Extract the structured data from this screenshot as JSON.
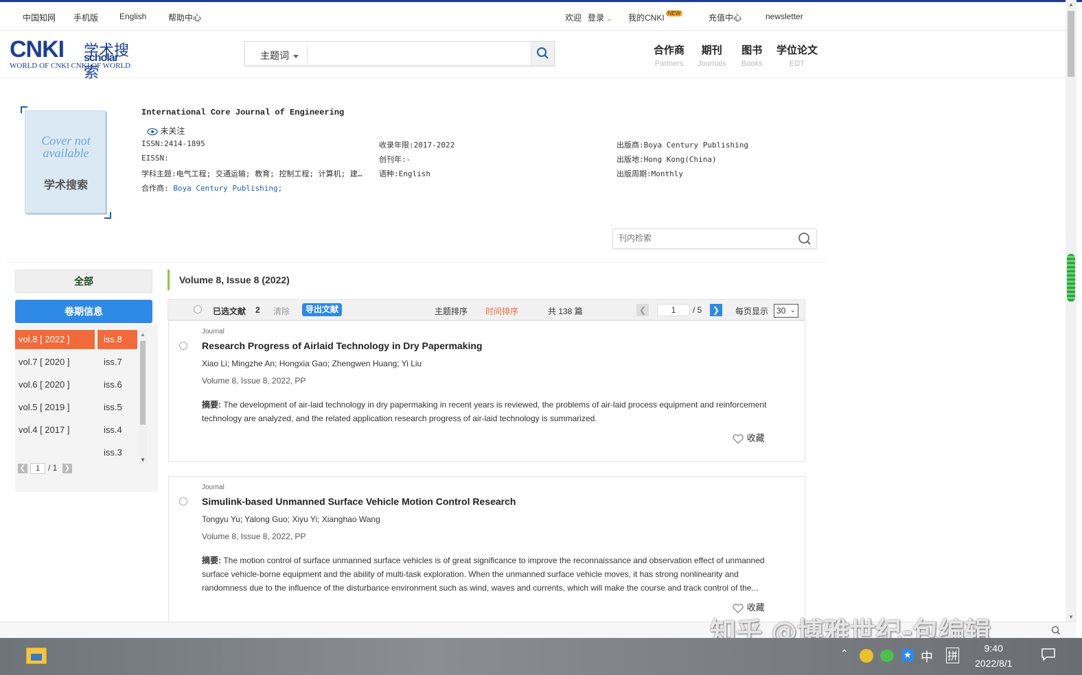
{
  "topbar": {
    "cnki_home": "中国知网",
    "mobile": "手机版",
    "english": "English",
    "help": "帮助中心",
    "welcome": "欢迎",
    "login": "登录",
    "my_cnki": "我的CNKI",
    "new_badge": "NEW",
    "recharge": "充值中心",
    "newsletter": "newsletter"
  },
  "logo": {
    "main": "CNKI",
    "cn": "学术搜索",
    "scholar": "scholar",
    "sub": "WORLD OF CNKI CNKI OF WORLD"
  },
  "search": {
    "type": "主题词",
    "placeholder": ""
  },
  "nav": [
    {
      "cn": "合作商",
      "en": "Partners"
    },
    {
      "cn": "期刊",
      "en": "Journals"
    },
    {
      "cn": "图书",
      "en": "Books"
    },
    {
      "cn": "学位论文",
      "en": "EDT"
    }
  ],
  "cover": {
    "text": "Cover not available",
    "logo_text": "学术搜索"
  },
  "journal": {
    "title": "International Core Journal of Engineering",
    "follow": "未关注",
    "issn": "ISSN:2414-1895",
    "eissn": "EISSN:",
    "subjects": "学科主题:电气工程; 交通运输; 教育; 控制工程; 计算机; 建…",
    "partner_label": "合作商:",
    "partner_value": "Boya Century Publishing;",
    "years": "收录年限:2017-2022",
    "founded": "创刊年:-",
    "language": "语种:English",
    "publisher": "出版商:Boya Century Publishing",
    "location": "出版地:Hong Kong(China)",
    "cycle": "出版周期:Monthly"
  },
  "inner_search": {
    "placeholder": "刊内检索"
  },
  "sidebar": {
    "all": "全部",
    "issue_info": "卷期信息",
    "volumes": [
      "vol.8 [ 2022 ]",
      "vol.7 [ 2020 ]",
      "vol.6 [ 2020 ]",
      "vol.5 [ 2019 ]",
      "vol.4 [ 2017 ]"
    ],
    "issues": [
      "iss.8",
      "iss.7",
      "iss.6",
      "iss.5",
      "iss.4",
      "iss.3"
    ],
    "page": "1",
    "total": "/ 1"
  },
  "main": {
    "volume_title": "Volume 8, Issue 8 (2022)",
    "toolbar": {
      "selected": "已选文献",
      "selected_count": "2",
      "clear": "清除",
      "export": "导出文献",
      "sort_topic": "主题排序",
      "sort_time": "时间排序",
      "total": "共 138 篇",
      "page": "1",
      "pages": "/ 5",
      "per_page_label": "每页显示",
      "per_page": "30"
    },
    "articles": [
      {
        "kind": "Journal",
        "title": "Research Progress of Airlaid Technology in Dry Papermaking",
        "authors": "Xiao Li; Mingzhe An; Hongxia Gao; Zhengwen Huang; Yi Liu",
        "volume": "Volume 8, Issue 8, 2022, PP",
        "abstract_label": "摘要:",
        "abstract": "The development of air-laid technology in dry papermaking in recent years is reviewed, the problems of air-laid process equipment and reinforcement technology are analyzed, and the related application research progress of air-laid technology is summarized.",
        "fav": "收藏"
      },
      {
        "kind": "Journal",
        "title": "Simulink-based Unmanned Surface Vehicle Motion Control Research",
        "authors": "Tongyu Yu; Yalong Guo; Xiyu Yi; Xianghao Wang",
        "volume": "Volume 8, Issue 8, 2022, PP",
        "abstract_label": "摘要:",
        "abstract": "The motion control of surface unmanned surface vehicles is of great significance to improve the reconnaissance and observation effect of unmanned surface vehicle-borne equipment and the ability of multi-task exploration. When the unmanned surface vehicle moves, it has strong nonlinearity and randomness due to the influence of the disturbance environment such as wind, waves and currents, which will make the course and track control of the...",
        "fav": "收藏"
      }
    ]
  },
  "watermark": "知乎 @博雅世纪-包编辑",
  "taskbar": {
    "ime_zh": "中",
    "ime_pin": "拼",
    "time": "9:40",
    "date": "2022/8/1"
  },
  "colors": {
    "brand": "#1c3f94",
    "accent_blue": "#2e8ae6",
    "active_orange": "#f06a3c",
    "time_sort": "#f06a3c"
  }
}
